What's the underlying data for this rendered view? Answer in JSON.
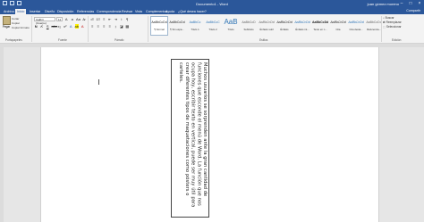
{
  "window": {
    "title": "Documento1 - Word",
    "user": "juan gómez moreno"
  },
  "tabs": [
    "Archivo",
    "Inicio",
    "Insertar",
    "Diseño",
    "Disposición",
    "Referencias",
    "Correspondencia",
    "Revisar",
    "Vista",
    "Complementos",
    "Ayuda",
    "¿Qué desea hacer?"
  ],
  "share": "Compartir",
  "clipboard": {
    "paste": "Pegar",
    "cut": "Cortar",
    "copy": "Copiar",
    "format_painter": "Copiar formato",
    "label": "Portapapeles"
  },
  "font": {
    "name": "Calibri (Cuerpo)",
    "size": "11",
    "label": "Fuente"
  },
  "paragraph": {
    "label": "Párrafo"
  },
  "styles": {
    "label": "Estilos",
    "items": [
      {
        "sample": "AaBbCcDd",
        "name": "¶ Normal"
      },
      {
        "sample": "AaBbCcDd",
        "name": "¶ Sin espa..."
      },
      {
        "sample": "AaBbCc",
        "name": "Título 1"
      },
      {
        "sample": "AaBbCcC",
        "name": "Título 2"
      },
      {
        "sample": "AaB",
        "name": "Título"
      },
      {
        "sample": "AaBbCcD",
        "name": "Subtítulo"
      },
      {
        "sample": "AaBbCcDd",
        "name": "Énfasis sutil"
      },
      {
        "sample": "AaBbCcDd",
        "name": "Énfasis"
      },
      {
        "sample": "AaBbCcDd",
        "name": "Énfasis int..."
      },
      {
        "sample": "AaBbCcDd",
        "name": "Texto en n..."
      },
      {
        "sample": "AaBbCcDd",
        "name": "Cita"
      },
      {
        "sample": "AaBbCcDd",
        "name": "Cita desta..."
      },
      {
        "sample": "AaBbCcDd",
        "name": "Referencia..."
      }
    ]
  },
  "editing": {
    "find": "Buscar",
    "replace": "Reemplazar",
    "select": "Seleccionar",
    "label": "Edición"
  },
  "document": {
    "textbox": "Muchos usuarios se sorprenden ante la gran cantidad de funciones que esconde el menú de Word. La función que nos ocupa hoy, escribir texto en vertical, puede ser muy útil para crear diferentes tipos de maquetaciones como pósters o carteles."
  }
}
